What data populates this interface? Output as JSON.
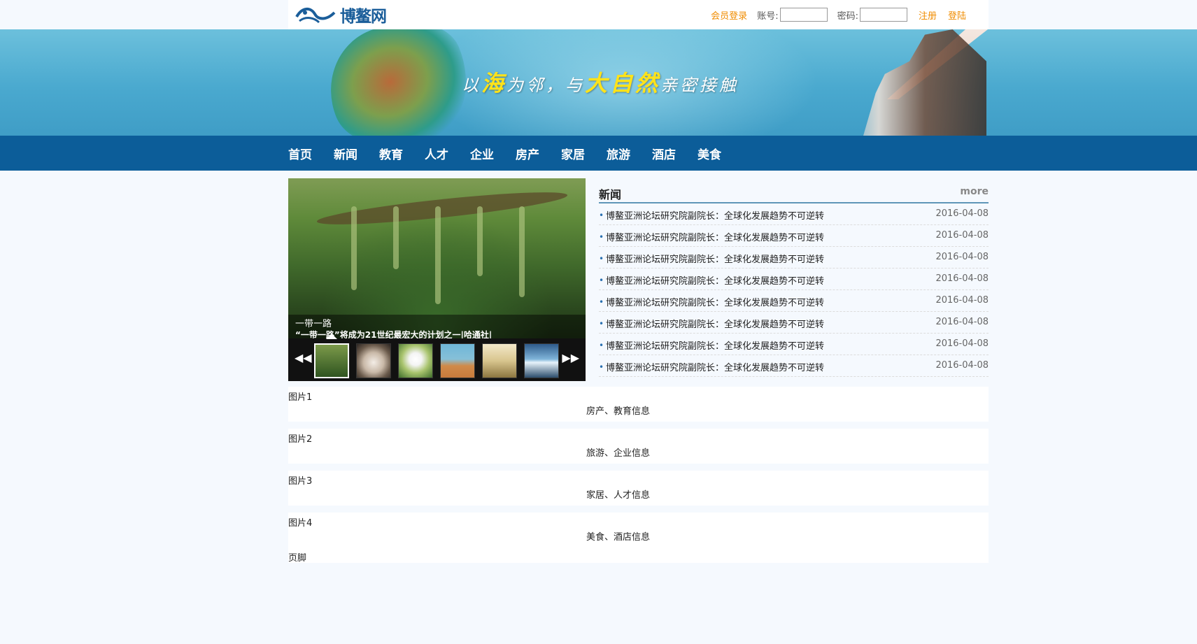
{
  "site": {
    "logo_text": "博鳌网",
    "slogan": {
      "p1": "以",
      "hl1": "海",
      "p2": "为邻，与",
      "hl2": "大自然",
      "p3": "亲密接触"
    }
  },
  "login": {
    "member": "会员登录",
    "account_label": "账号:",
    "password_label": "密码:",
    "register": "注册",
    "submit": "登陆",
    "account_value": "",
    "password_value": ""
  },
  "nav": [
    "首页",
    "新闻",
    "教育",
    "人才",
    "企业",
    "房产",
    "家居",
    "旅游",
    "酒店",
    "美食"
  ],
  "slider": {
    "caption_title": "一带一路",
    "caption_sub": "“一带一路”将成为21世纪最宏大的计划之一|哈通社|",
    "prev": "◀◀",
    "next": "▶▶",
    "active_index": 0,
    "thumb_count": 6
  },
  "news": {
    "title": "新闻",
    "more": "more",
    "items": [
      {
        "title": "博鳌亚洲论坛研究院副院长：全球化发展趋势不可逆转",
        "date": "2016-04-08"
      },
      {
        "title": "博鳌亚洲论坛研究院副院长：全球化发展趋势不可逆转",
        "date": "2016-04-08"
      },
      {
        "title": "博鳌亚洲论坛研究院副院长：全球化发展趋势不可逆转",
        "date": "2016-04-08"
      },
      {
        "title": "博鳌亚洲论坛研究院副院长：全球化发展趋势不可逆转",
        "date": "2016-04-08"
      },
      {
        "title": "博鳌亚洲论坛研究院副院长：全球化发展趋势不可逆转",
        "date": "2016-04-08"
      },
      {
        "title": "博鳌亚洲论坛研究院副院长：全球化发展趋势不可逆转",
        "date": "2016-04-08"
      },
      {
        "title": "博鳌亚洲论坛研究院副院长：全球化发展趋势不可逆转",
        "date": "2016-04-08"
      },
      {
        "title": "博鳌亚洲论坛研究院副院长：全球化发展趋势不可逆转",
        "date": "2016-04-08"
      }
    ]
  },
  "blocks": [
    {
      "pic": "图片1",
      "info": "房产、教育信息"
    },
    {
      "pic": "图片2",
      "info": "旅游、企业信息"
    },
    {
      "pic": "图片3",
      "info": "家居、人才信息"
    },
    {
      "pic": "图片4",
      "info": "美食、酒店信息"
    }
  ],
  "footer": "页脚"
}
